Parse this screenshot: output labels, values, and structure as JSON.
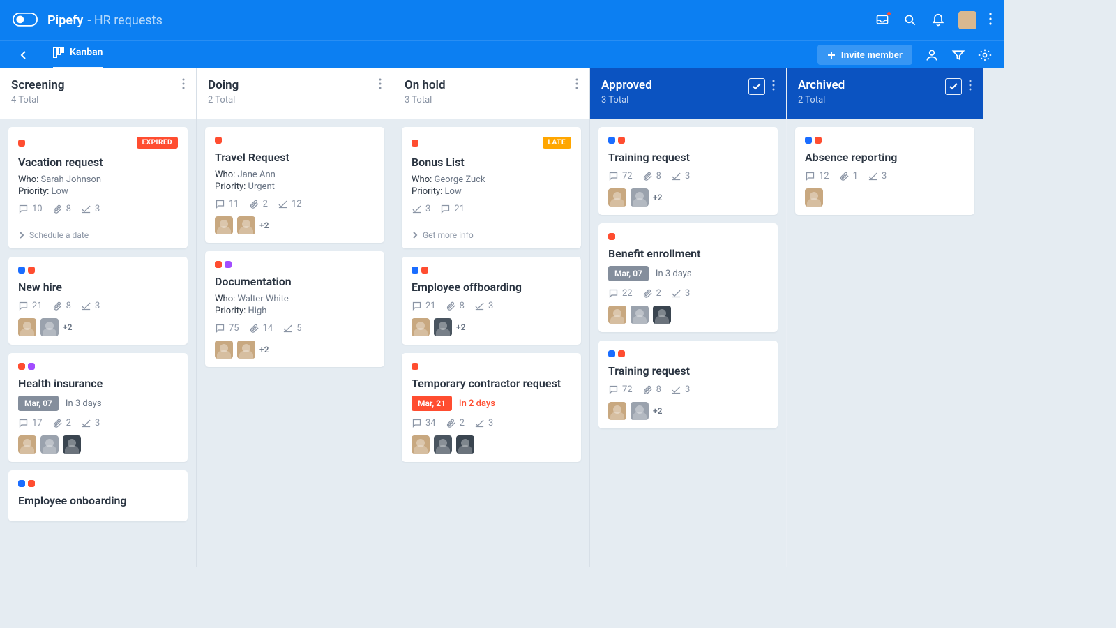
{
  "header": {
    "app": "Pipefy",
    "subtitle": "HR requests",
    "invite_label": "Invite member",
    "view_label": "Kanban"
  },
  "columns": [
    {
      "name": "Screening",
      "total_label": "4 Total",
      "done": false,
      "cards": [
        {
          "labels": [
            "red"
          ],
          "tag": "EXPIRED",
          "tag_kind": "expired",
          "title": "Vacation request",
          "fields": [
            [
              "Who:",
              "Sarah Johnson"
            ],
            [
              "Priority:",
              "Low"
            ]
          ],
          "stats": {
            "comments": 10,
            "attachments": 8,
            "checks": 3
          },
          "action": "Schedule a date"
        },
        {
          "labels": [
            "blue",
            "red"
          ],
          "title": "New hire",
          "stats": {
            "comments": 21,
            "attachments": 8,
            "checks": 3
          },
          "avatars": [
            "a",
            "gray"
          ],
          "more": "+2"
        },
        {
          "labels": [
            "red",
            "purple"
          ],
          "title": "Health insurance",
          "date": "Mar, 07",
          "date_rel": "In 3 days",
          "stats": {
            "comments": 17,
            "attachments": 2,
            "checks": 3
          },
          "avatars": [
            "a",
            "gray",
            "sun"
          ]
        },
        {
          "labels": [
            "blue",
            "red"
          ],
          "title": "Employee onboarding"
        }
      ]
    },
    {
      "name": "Doing",
      "total_label": "2 Total",
      "done": false,
      "cards": [
        {
          "labels": [
            "red"
          ],
          "title": "Travel Request",
          "fields": [
            [
              "Who:",
              "Jane Ann"
            ],
            [
              "Priority:",
              "Urgent"
            ]
          ],
          "stats": {
            "comments": 11,
            "attachments": 2,
            "checks": 12
          },
          "avatars": [
            "a",
            "b"
          ],
          "more": "+2"
        },
        {
          "labels": [
            "red",
            "purple"
          ],
          "title": "Documentation",
          "fields": [
            [
              "Who:",
              "Walter White"
            ],
            [
              "Priority:",
              "High"
            ]
          ],
          "stats": {
            "comments": 75,
            "attachments": 14,
            "checks": 5
          },
          "avatars": [
            "a",
            "b"
          ],
          "more": "+2"
        }
      ]
    },
    {
      "name": "On hold",
      "total_label": "3 Total",
      "done": false,
      "cards": [
        {
          "labels": [
            "red"
          ],
          "tag": "LATE",
          "tag_kind": "late",
          "title": "Bonus List",
          "fields": [
            [
              "Who:",
              "George Zuck"
            ],
            [
              "Priority:",
              "Low"
            ]
          ],
          "stats_order": [
            "checks",
            "comments"
          ],
          "stats": {
            "checks": 3,
            "comments": 21
          },
          "action": "Get more info"
        },
        {
          "labels": [
            "blue",
            "red"
          ],
          "title": "Employee offboarding",
          "stats": {
            "comments": 21,
            "attachments": 8,
            "checks": 3
          },
          "avatars": [
            "a",
            "dark"
          ],
          "more": "+2"
        },
        {
          "labels": [
            "red"
          ],
          "title": "Temporary contractor request",
          "date": "Mar, 21",
          "date_rel": "In 2 days",
          "date_urgent": true,
          "stats": {
            "comments": 34,
            "attachments": 2,
            "checks": 3
          },
          "avatars": [
            "a",
            "dark",
            "sun"
          ]
        }
      ]
    },
    {
      "name": "Approved",
      "total_label": "3 Total",
      "done": true,
      "cards": [
        {
          "labels": [
            "blue",
            "red"
          ],
          "title": "Training request",
          "stats": {
            "comments": 72,
            "attachments": 8,
            "checks": 3
          },
          "avatars": [
            "a",
            "gray"
          ],
          "more": "+2"
        },
        {
          "labels": [
            "red"
          ],
          "title": "Benefit enrollment",
          "date": "Mar, 07",
          "date_rel": "In 3 days",
          "stats": {
            "comments": 22,
            "attachments": 2,
            "checks": 3
          },
          "avatars": [
            "a",
            "gray",
            "sun"
          ]
        },
        {
          "labels": [
            "blue",
            "red"
          ],
          "title": "Training request",
          "stats": {
            "comments": 72,
            "attachments": 8,
            "checks": 3
          },
          "avatars": [
            "a",
            "gray"
          ],
          "more": "+2"
        }
      ]
    },
    {
      "name": "Archived",
      "total_label": "2 Total",
      "done": true,
      "cards": [
        {
          "labels": [
            "blue",
            "red"
          ],
          "title": "Absence reporting",
          "stats": {
            "comments": 12,
            "attachments": 1,
            "checks": 3
          },
          "avatars": [
            "a"
          ]
        }
      ]
    }
  ]
}
